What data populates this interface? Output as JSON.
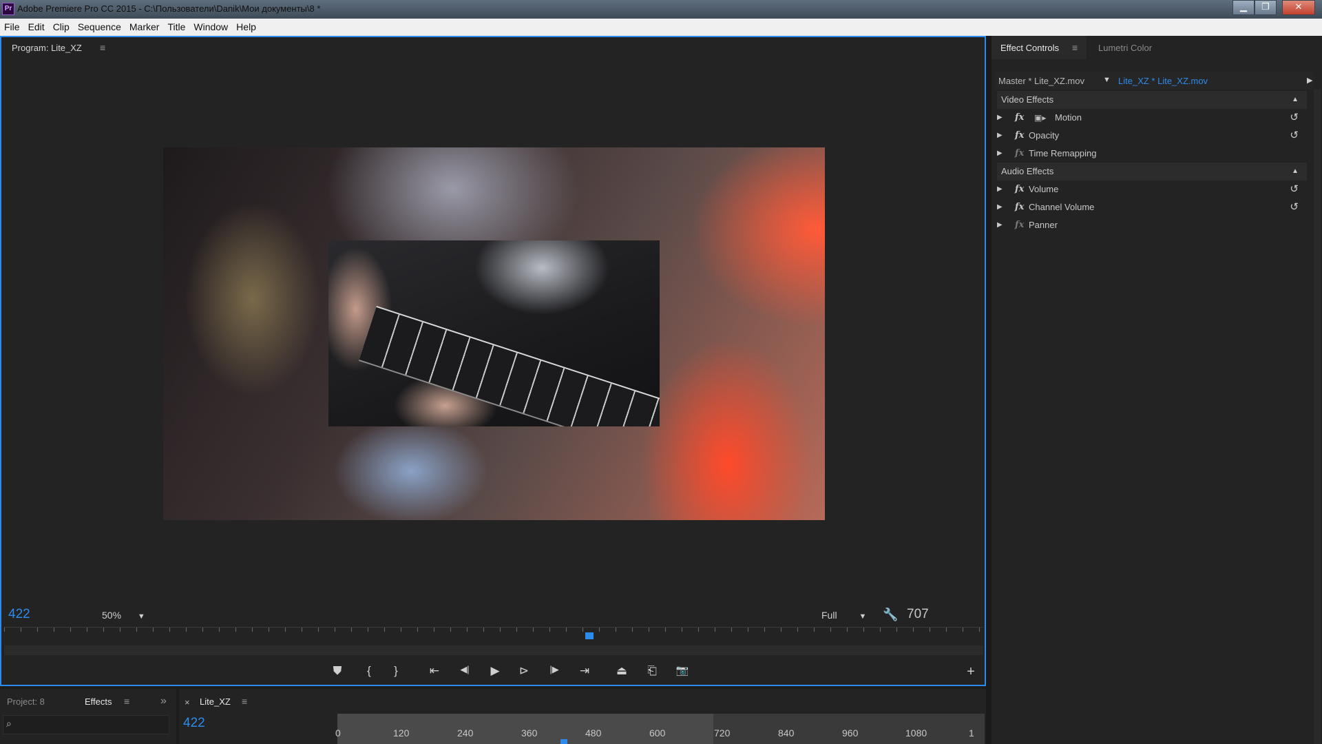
{
  "window": {
    "title": "Adobe Premiere Pro CC 2015 - C:\\Пользователи\\Danik\\Мои документы\\8 *",
    "app_icon_label": "Pr",
    "controls": {
      "minimize": "▁",
      "maximize": "❐",
      "close": "✕"
    }
  },
  "menu": [
    "File",
    "Edit",
    "Clip",
    "Sequence",
    "Marker",
    "Title",
    "Window",
    "Help"
  ],
  "program_monitor": {
    "tab_label": "Program: Lite_XZ",
    "menu_glyph": "≡",
    "timecode_current": "422",
    "zoom": "50%",
    "quality": "Full",
    "timecode_duration": "707",
    "controls": [
      {
        "name": "add-marker-icon",
        "glyph": "⛊"
      },
      {
        "name": "mark-in-icon",
        "glyph": "{"
      },
      {
        "name": "mark-out-icon",
        "glyph": "}"
      },
      {
        "name": "go-to-in-icon",
        "glyph": "⇤"
      },
      {
        "name": "step-back-icon",
        "glyph": "◀|"
      },
      {
        "name": "play-icon",
        "glyph": "▶"
      },
      {
        "name": "play-in-to-out-icon",
        "glyph": "⊳"
      },
      {
        "name": "step-forward-icon",
        "glyph": "|▶"
      },
      {
        "name": "go-to-out-icon",
        "glyph": "⇥"
      },
      {
        "name": "lift-icon",
        "glyph": "⏏"
      },
      {
        "name": "extract-icon",
        "glyph": "⎗"
      },
      {
        "name": "export-frame-icon",
        "glyph": "📷"
      }
    ],
    "add_button": "+"
  },
  "effect_controls": {
    "tabs": [
      {
        "label": "Effect Controls",
        "active": true
      },
      {
        "label": "Lumetri Color",
        "active": false
      }
    ],
    "menu_glyph": "≡",
    "master_clip": "Master * Lite_XZ.mov",
    "sequence_clip": "Lite_XZ * Lite_XZ.mov",
    "video_section": "Video Effects",
    "video_effects": [
      {
        "label": "Motion",
        "reset": true,
        "has_transform_icon": true
      },
      {
        "label": "Opacity",
        "reset": true
      },
      {
        "label": "Time Remapping",
        "reset": false
      }
    ],
    "audio_section": "Audio Effects",
    "audio_effects": [
      {
        "label": "Volume",
        "reset": true
      },
      {
        "label": "Channel Volume",
        "reset": true
      },
      {
        "label": "Panner",
        "reset": false
      }
    ],
    "fx_glyph": "fx"
  },
  "project_panel": {
    "tabs": [
      {
        "label": "Project: 8",
        "active": false
      },
      {
        "label": "Effects",
        "active": true
      }
    ],
    "overflow_glyph": "»"
  },
  "timeline": {
    "close_glyph": "×",
    "tab_label": "Lite_XZ",
    "timecode": "422",
    "ruler_ticks": [
      "0",
      "120",
      "240",
      "360",
      "480",
      "600",
      "720",
      "840",
      "960",
      "1080",
      "1"
    ]
  },
  "colors": {
    "accent_blue": "#2d8ceb",
    "panel_bg": "#232323",
    "menubar_bg": "#f0f0f0"
  }
}
